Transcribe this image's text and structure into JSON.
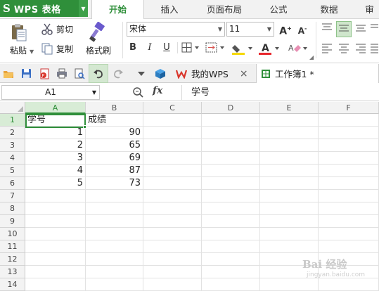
{
  "app": {
    "logo": "S",
    "name": "WPS 表格"
  },
  "tabs": [
    {
      "label": "开始",
      "active": true
    },
    {
      "label": "插入"
    },
    {
      "label": "页面布局"
    },
    {
      "label": "公式"
    },
    {
      "label": "数据"
    },
    {
      "label": "审"
    }
  ],
  "ribbon": {
    "paste_label": "粘贴",
    "cut_label": "剪切",
    "copy_label": "复制",
    "format_painter_label": "格式刷",
    "font_name": "宋体",
    "font_size": "11",
    "bold": "B",
    "italic": "I",
    "underline": "U"
  },
  "quickbar": {
    "doc_tabs": [
      {
        "label": "我的WPS",
        "close": "×"
      },
      {
        "label": "工作簿1 *",
        "active": true
      }
    ]
  },
  "formula_bar": {
    "cell_ref": "A1",
    "fx": "fx",
    "value": "学号"
  },
  "sheet": {
    "columns": [
      "A",
      "B",
      "C",
      "D",
      "E",
      "F"
    ],
    "rows": [
      "1",
      "2",
      "3",
      "4",
      "5",
      "6",
      "7",
      "8",
      "9",
      "10",
      "11",
      "12",
      "13",
      "14"
    ],
    "cells": {
      "A1": "学号",
      "B1": "成绩",
      "A2": "1",
      "B2": "90",
      "A3": "2",
      "B3": "65",
      "A4": "3",
      "B4": "69",
      "A5": "4",
      "B5": "87",
      "A6": "5",
      "B6": "73"
    }
  },
  "watermark": {
    "text": "Bai 经验",
    "sub": "jingyan.baidu.com"
  },
  "colors": {
    "accent": "#2f8f3a",
    "tab_bg": "#f2f2f2"
  }
}
